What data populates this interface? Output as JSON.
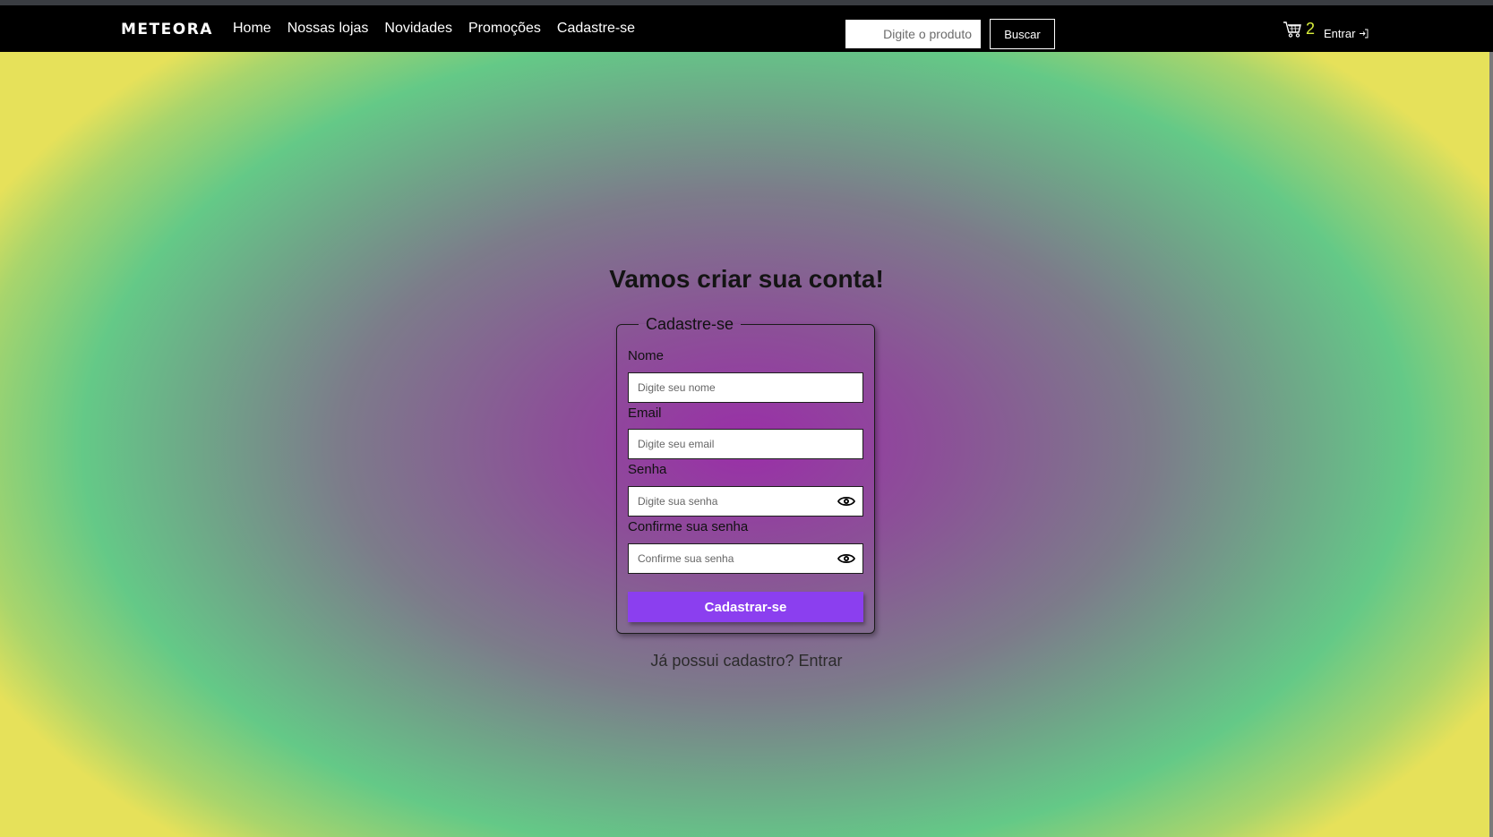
{
  "header": {
    "logo": "METEORA",
    "nav": [
      "Home",
      "Nossas lojas",
      "Novidades",
      "Promoções",
      "Cadastre-se"
    ],
    "search_placeholder": "Digite o produto",
    "search_button": "Buscar",
    "cart_count": "2",
    "login_label": "Entrar"
  },
  "main": {
    "title": "Vamos criar sua conta!",
    "form": {
      "legend": "Cadastre-se",
      "name_label": "Nome",
      "name_placeholder": "Digite seu nome",
      "email_label": "Email",
      "email_placeholder": "Digite seu email",
      "password_label": "Senha",
      "password_placeholder": "Digite sua senha",
      "confirm_label": "Confirme sua senha",
      "confirm_placeholder": "Confirme sua senha",
      "submit_label": "Cadastrar-se"
    },
    "already_text": "Já possui cadastro?",
    "already_link": "Entrar"
  },
  "colors": {
    "accent": "#8b3fef",
    "cart_count": "#d9ef3b",
    "navbar": "#000000"
  }
}
